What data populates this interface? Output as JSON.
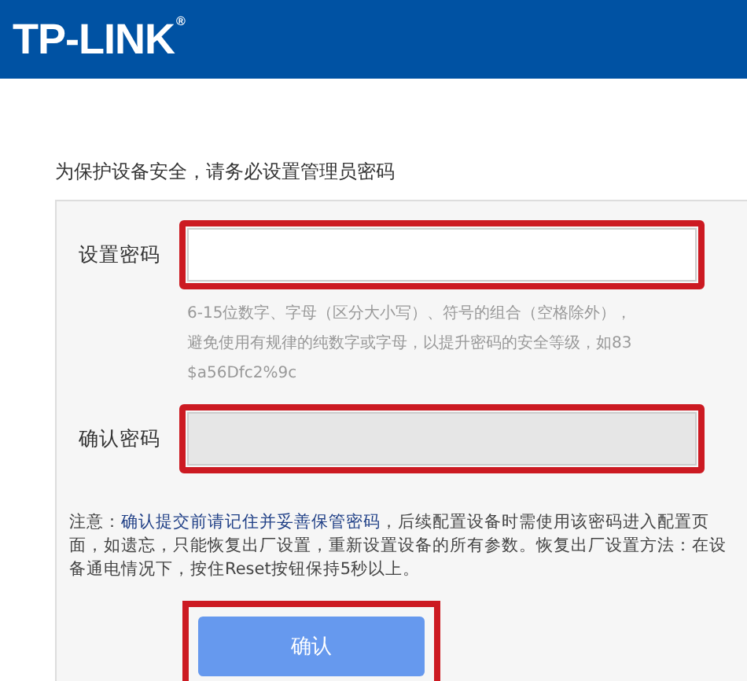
{
  "header": {
    "logo": "TP-LINK$^{®}$"
  },
  "intro": "为保护设备安全，请务必设置管理员密码",
  "fields": [
    {
      "label": "设置密码",
      "disabled": false,
      "highlighted": true,
      "hint": [
        "6-15位数字、字母（区分大小写）、符号的组合（空格除外），",
        "避免使用有规律的纯数字或字母，以提升密码的安全等级，如83",
        "$a56Dfc2%9c"
      ]
    },
    {
      "label": "确认密码",
      "disabled": true,
      "highlighted": true
    }
  ],
  "note": "注意：**确认提交前请记住并妥善保管密码**，后续配置设备时需使用该密码进入配置页面，如遗忘，只能恢复出厂设置，重新设置设备的所有参数。恢复出厂设置方法：在设备通电情况下，按住Reset按钮保持5秒以上。",
  "button": {
    "label": "确认",
    "highlighted": true
  }
}
